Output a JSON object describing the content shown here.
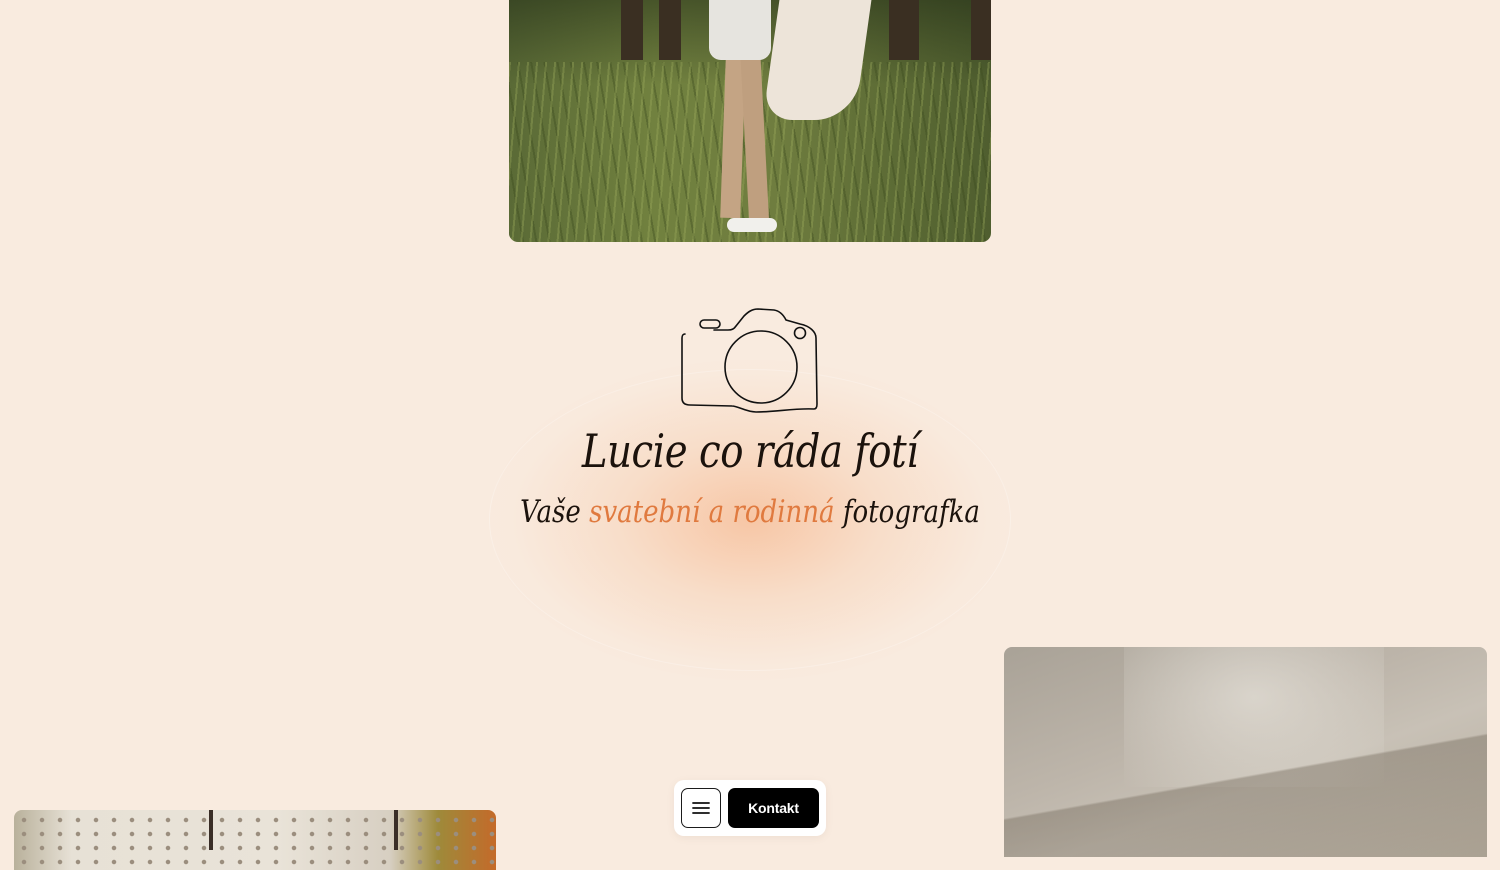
{
  "hero": {
    "title": "Lucie co ráda fotí",
    "subtitle_prefix": "Vaše",
    "subtitle_accent": "svatební a rodinná",
    "subtitle_suffix": "fotografka",
    "accent_color": "#e07a3f",
    "icon": "camera-icon"
  },
  "bottom_nav": {
    "menu_icon": "hamburger-menu-icon",
    "contact_label": "Kontakt"
  },
  "colors": {
    "background": "#f9ebdf",
    "text": "#1b120c",
    "button_dark": "#000000"
  }
}
